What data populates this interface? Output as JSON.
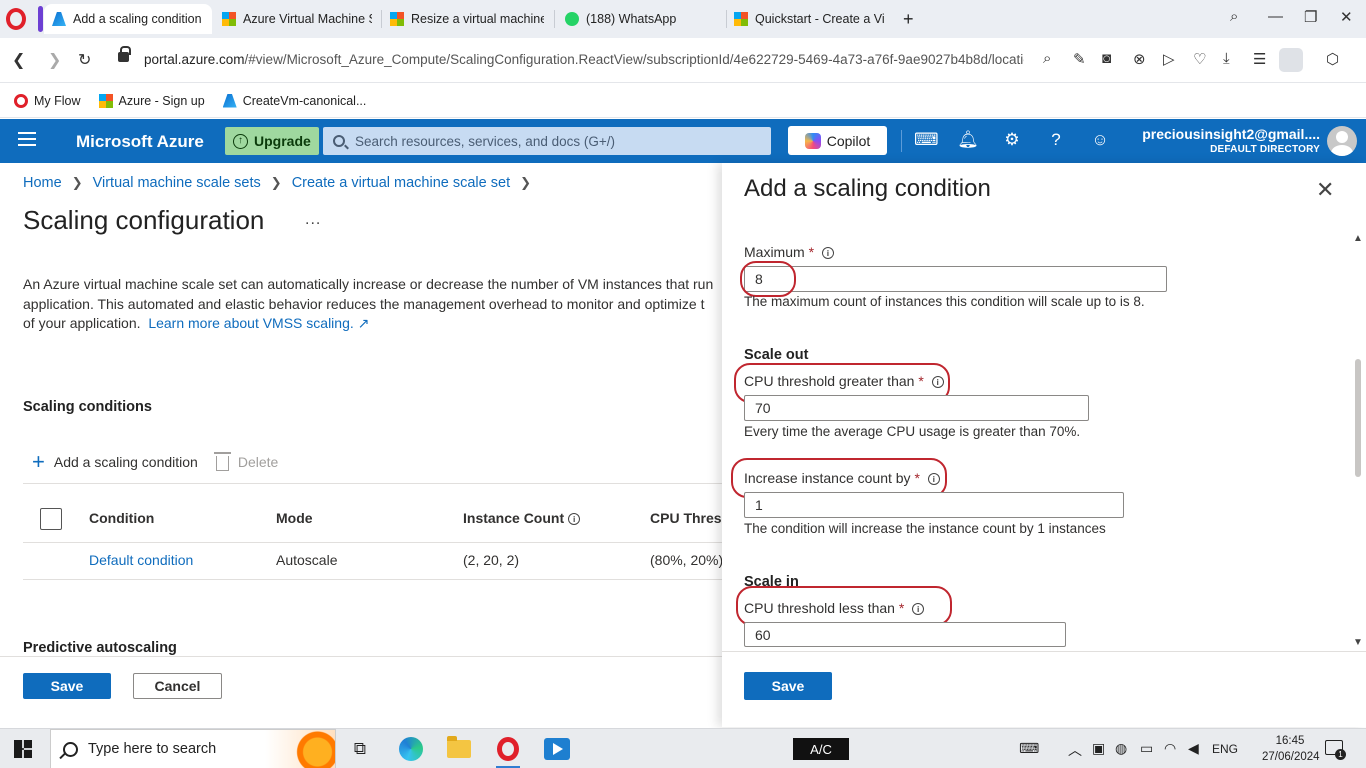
{
  "browser": {
    "tabs": [
      {
        "title": "Add a scaling condition -",
        "active": true,
        "favicon": "azure-icon"
      },
      {
        "title": "Azure Virtual Machine Sca",
        "favicon": "microsoft-icon"
      },
      {
        "title": "Resize a virtual machine -",
        "favicon": "microsoft-icon"
      },
      {
        "title": "(188) WhatsApp",
        "favicon": "whatsapp-icon"
      },
      {
        "title": "Quickstart - Create a Virtu",
        "favicon": "microsoft-icon"
      }
    ],
    "new_tab": "+",
    "url_domain": "portal.azure.com",
    "url_path": "/#view/Microsoft_Azure_Compute/ScalingConfiguration.ReactView/subscriptionId/4e622729-5469-4a73-a76f-9ae9027b4b8d/location/ea",
    "bookmarks": [
      "My Flow",
      "Azure - Sign up",
      "CreateVm-canonical..."
    ],
    "colors": {
      "opera_red": "#e0202a",
      "tab_strip": "#ebeef3"
    }
  },
  "azure_header": {
    "brand": "Microsoft Azure",
    "upgrade_label": "Upgrade",
    "search_placeholder": "Search resources, services, and docs (G+/)",
    "copilot_label": "Copilot",
    "user_email": "preciousinsight2@gmail....",
    "user_directory": "DEFAULT DIRECTORY",
    "icons": [
      "cloud-shell-icon",
      "bell-icon",
      "gear-icon",
      "help-icon",
      "feedback-icon"
    ],
    "colors": {
      "header_bg": "#0f6cbd",
      "upgrade_bg": "#9fd89f"
    }
  },
  "page": {
    "breadcrumb": [
      "Home",
      "Virtual machine scale sets",
      "Create a virtual machine scale set"
    ],
    "title": "Scaling configuration",
    "more": "...",
    "intro_line1": "An Azure virtual machine scale set can automatically increase or decrease the number of VM instances that run",
    "intro_line2": "application. This automated and elastic behavior reduces the management overhead to monitor and optimize t",
    "intro_line3": "of your application.",
    "intro_link": "Learn more about VMSS scaling.",
    "scaling_conditions_heading": "Scaling conditions",
    "add_condition_label": "Add a scaling condition",
    "delete_label": "Delete",
    "columns": [
      "Condition",
      "Mode",
      "Instance Count",
      "CPU Thresh"
    ],
    "rows": [
      {
        "condition": "Default condition",
        "mode": "Autoscale",
        "instance_count": "(2, 20, 2)",
        "cpu_threshold": "(80%, 20%)"
      }
    ],
    "predictive_heading": "Predictive autoscaling",
    "save_label": "Save",
    "cancel_label": "Cancel"
  },
  "panel": {
    "title": "Add a scaling condition",
    "maximum_label": "Maximum",
    "maximum_value": "8",
    "maximum_help": "The maximum count of instances this condition will scale up to is 8.",
    "scale_out_heading": "Scale out",
    "cpu_greater_label": "CPU threshold greater than",
    "cpu_greater_value": "70",
    "cpu_greater_help": "Every time the average CPU usage is greater than 70%.",
    "increase_label": "Increase instance count by",
    "increase_value": "1",
    "increase_help": "The condition will increase the instance count by 1 instances",
    "scale_in_heading": "Scale in",
    "cpu_less_label": "CPU threshold less than",
    "cpu_less_value": "60",
    "required_mark": "*",
    "save_label": "Save",
    "colors": {
      "annotation_ring": "#c0262f",
      "primary": "#0f6cbd"
    }
  },
  "taskbar": {
    "search_placeholder": "Type here to search",
    "ac_label": "A/C",
    "language": "ENG",
    "time": "16:45",
    "date": "27/06/2024",
    "notification_count": "1"
  }
}
